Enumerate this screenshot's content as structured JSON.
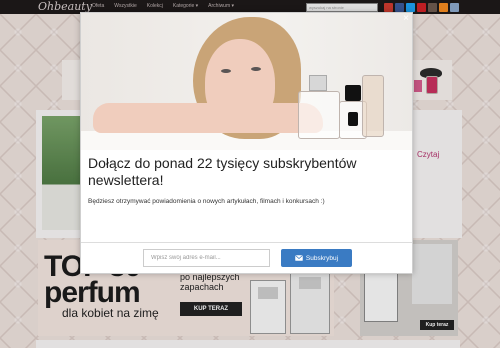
{
  "site": {
    "logo": "Ohbeauty",
    "nav": [
      "Ofeta",
      "Wszystkie",
      "Kolekcj",
      "Kategorie ▾",
      "Archiwum ▾"
    ],
    "search_placeholder": "wyszukaj na stronie",
    "social_colors": [
      "#d03b2f",
      "#3b5998",
      "#1da1f2",
      "#cc2127",
      "#6d5a4f",
      "#f48a20",
      "#8aa6c9"
    ],
    "sidebar_link": "Czytaj",
    "promo": {
      "headline_1": "TOP 30",
      "headline_2": "perfum",
      "sub": "dla kobiet na zimę",
      "side_text_1": "po najlepszych",
      "side_text_2": "zapachach",
      "button": "KUP TERAZ"
    },
    "ad_button": "Kup teraz"
  },
  "modal": {
    "close_label": "×",
    "title": "Dołącz do ponad 22 tysięcy subskrybentów newslettera!",
    "description": "Będziesz otrzymywać powiadomienia o nowych artykułach, filmach i konkursach :)",
    "email_placeholder": "Wpisz swój adres e-mail...",
    "subscribe_label": "Subskrybuj",
    "accent_color": "#3a7bc3"
  }
}
